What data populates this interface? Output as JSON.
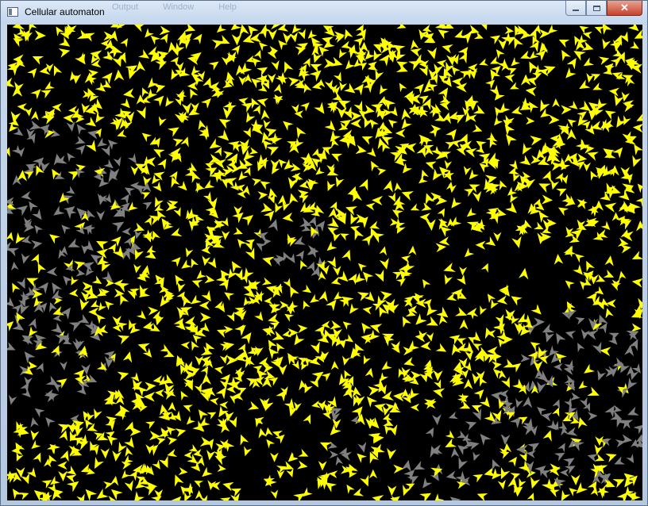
{
  "window": {
    "title": "Cellular automaton",
    "background_menu_ghost": [
      "Output",
      "Window",
      "Help"
    ],
    "caption_buttons": {
      "minimize_icon": "minimize-icon",
      "maximize_icon": "maximize-icon",
      "close_glyph": "✕"
    }
  },
  "simulation": {
    "background_color": "#000000",
    "agent_colors": {
      "active": "#ffff00",
      "inactive": "#808080"
    },
    "agent_icon": "arrowhead-icon"
  }
}
